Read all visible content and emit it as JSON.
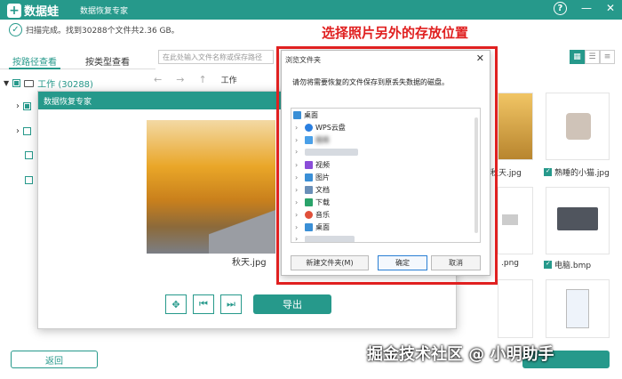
{
  "app": {
    "name": "数据蛙",
    "subtitle": "数据恢复专家",
    "help_label": "?",
    "minimize_label": "—",
    "close_label": "✕"
  },
  "status": {
    "text": "扫描完成。找到30288个文件共2.36 GB。"
  },
  "tabs": [
    {
      "label": "按路径查看",
      "active": true
    },
    {
      "label": "按类型查看",
      "active": false
    }
  ],
  "search": {
    "placeholder": "在此处输入文件名称或保存路径"
  },
  "tree": {
    "root_label": "工作 (30288)"
  },
  "nav": {
    "path": "工作"
  },
  "thumbs": [
    {
      "label": "秋天.jpg",
      "checked": false
    },
    {
      "label": "熟睡的小猫.jpg",
      "checked": true
    },
    {
      "label": ".png",
      "checked": false
    },
    {
      "label": "电脑.bmp",
      "checked": true
    }
  ],
  "preview": {
    "title": "数据恢复专家",
    "filename": "秋天.jpg",
    "export_label": "导出"
  },
  "bottom": {
    "back_label": "返回"
  },
  "dialog": {
    "title": "浏览文件夹",
    "message": "请勿将需要恢复的文件保存到原丢失数据的磁盘。",
    "items": [
      {
        "label": "桌面",
        "icon": "desktop-icon"
      },
      {
        "label": "WPS云盘",
        "icon": "cloud-icon"
      },
      {
        "label": "图库",
        "icon": "gallery-icon"
      },
      {
        "label": "视频",
        "icon": "video-icon"
      },
      {
        "label": "图片",
        "icon": "picture-icon"
      },
      {
        "label": "文档",
        "icon": "document-icon"
      },
      {
        "label": "下载",
        "icon": "download-icon"
      },
      {
        "label": "音乐",
        "icon": "music-icon"
      },
      {
        "label": "桌面",
        "icon": "desktop-icon"
      }
    ],
    "new_folder_label": "新建文件夹(M)",
    "ok_label": "确定",
    "cancel_label": "取消"
  },
  "annotation": {
    "text": "选择照片另外的存放位置"
  },
  "watermark": {
    "text": "掘金技术社区 @ 小明助手"
  },
  "colors": {
    "brand": "#26998b",
    "annotation": "#e02020"
  }
}
